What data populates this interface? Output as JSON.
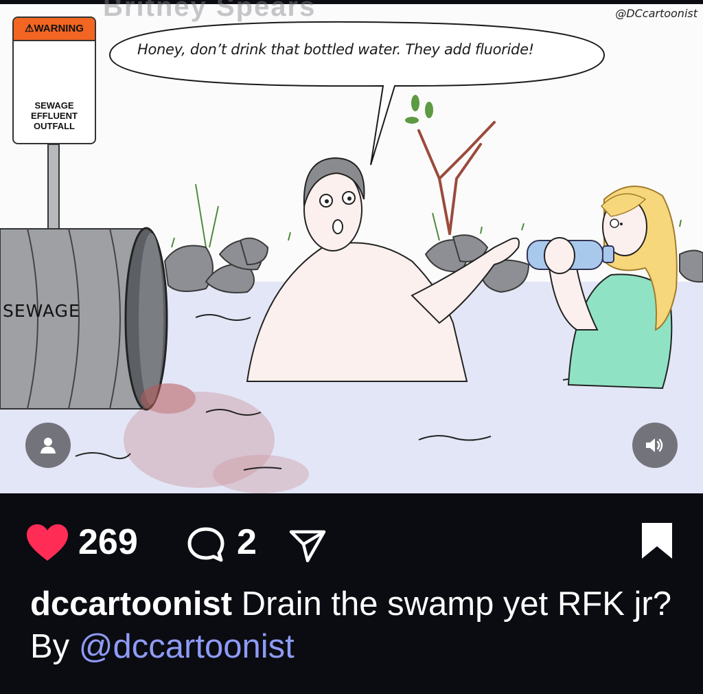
{
  "header": {
    "ghost_text": "Britney Spears"
  },
  "cartoon": {
    "credit": "@DCcartoonist",
    "speech": "Honey, don’t drink that bottled water. They add fluoride!",
    "sign": {
      "header": "⚠WARNING",
      "line1": "SEWAGE",
      "line2": "EFFLUENT",
      "line3": "OUTFALL"
    },
    "pipe_label": "SEWAGE"
  },
  "overlay": {
    "user_icon": "user-tag-icon",
    "sound_icon": "speaker-icon"
  },
  "actions": {
    "likes": "269",
    "comments": "2",
    "icons": [
      "heart-icon",
      "comment-icon",
      "share-icon",
      "bookmark-icon"
    ],
    "heart_color": "#ff2d55"
  },
  "caption": {
    "username": "dccartoonist",
    "text": " Drain the swamp yet RFK jr? By ",
    "mention": "@dccartoonist",
    "mention_color": "#8e9bf6"
  }
}
